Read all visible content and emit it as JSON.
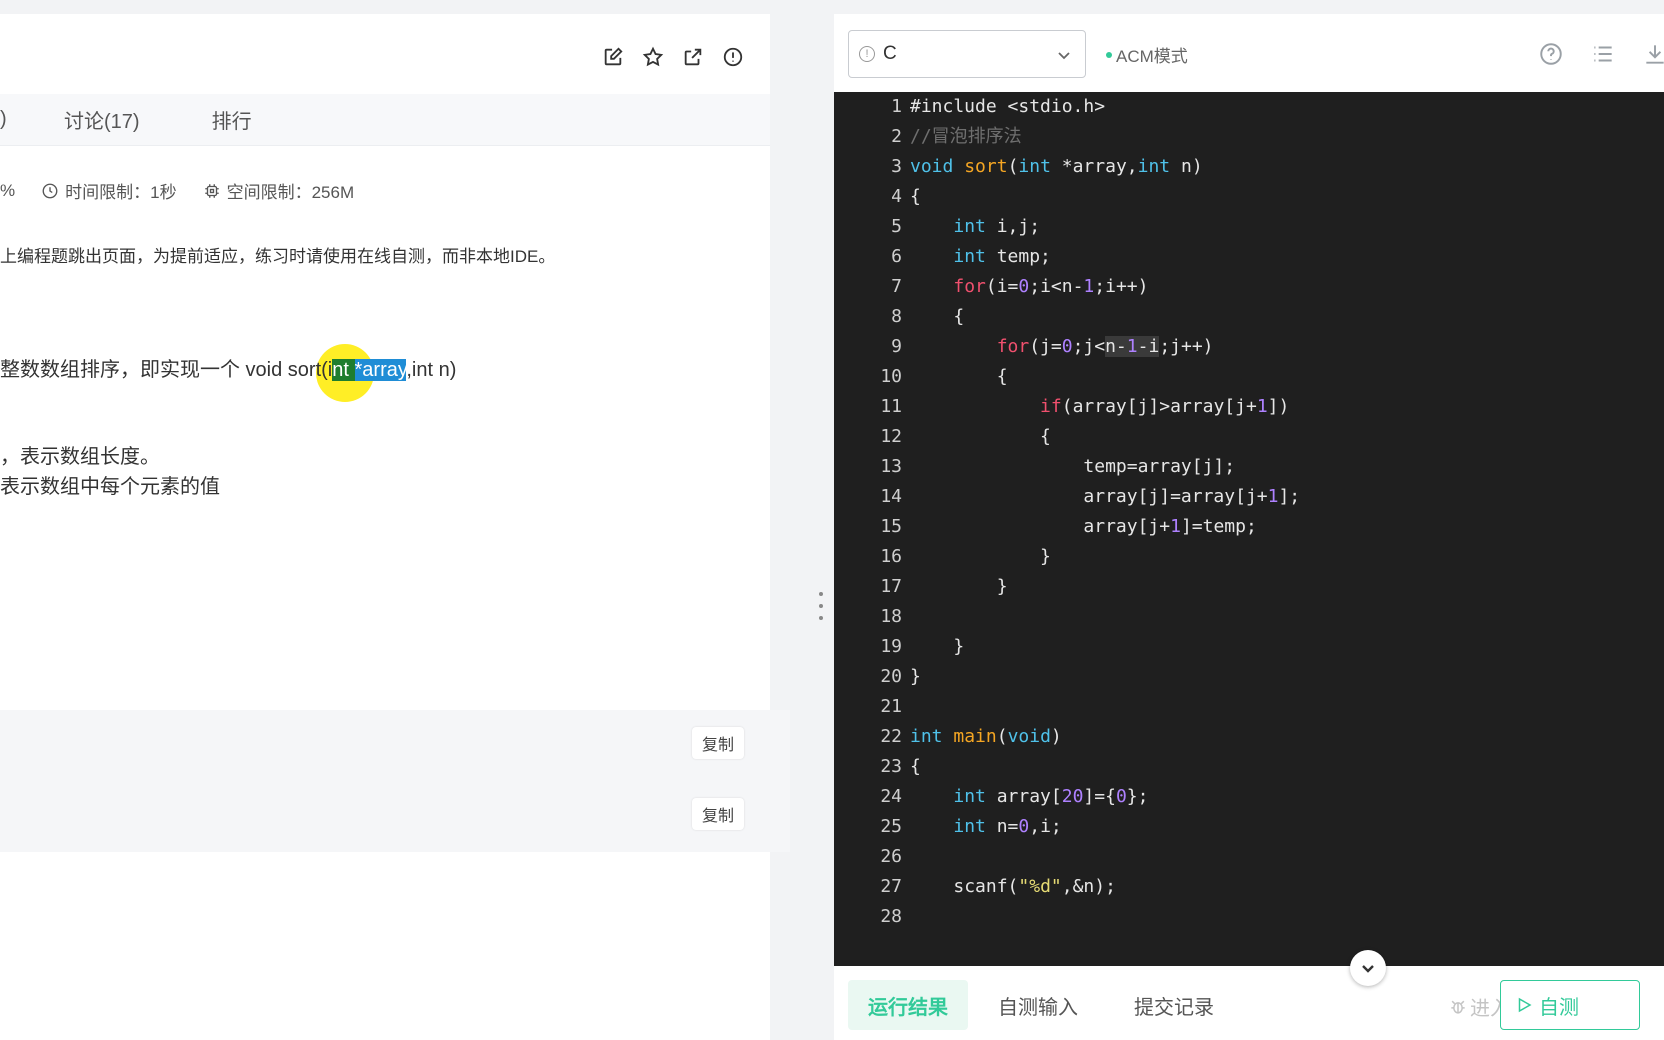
{
  "left": {
    "tabs": {
      "prev": ")",
      "discuss": "讨论(17)",
      "rank": "排行"
    },
    "meta": {
      "percent": "%",
      "time_limit": "时间限制：1秒",
      "space_limit": "空间限制：256M"
    },
    "notice": "上编程题跳出页面，为提前适应，练习时请使用在线自测，而非本地IDE。",
    "description": {
      "prefix": "整数数组排序，即实现一个 void sort(i",
      "green": "nt ",
      "blue": "*array",
      "suffix": ",int n)"
    },
    "input_desc": [
      "，表示数组长度。",
      "表示数组中每个元素的值"
    ],
    "copy_label_1": "复制",
    "copy_label_2": "复制"
  },
  "editor_header": {
    "language": "C",
    "mode": "ACM模式"
  },
  "code_lines": [
    {
      "n": "1"
    },
    {
      "n": "2"
    },
    {
      "n": "3"
    },
    {
      "n": "4"
    },
    {
      "n": "5"
    },
    {
      "n": "6"
    },
    {
      "n": "7"
    },
    {
      "n": "8"
    },
    {
      "n": "9"
    },
    {
      "n": "10"
    },
    {
      "n": "11"
    },
    {
      "n": "12"
    },
    {
      "n": "13"
    },
    {
      "n": "14"
    },
    {
      "n": "15"
    },
    {
      "n": "16"
    },
    {
      "n": "17"
    },
    {
      "n": "18"
    },
    {
      "n": "19"
    },
    {
      "n": "20"
    },
    {
      "n": "21"
    },
    {
      "n": "22"
    },
    {
      "n": "23"
    },
    {
      "n": "24"
    },
    {
      "n": "25"
    },
    {
      "n": "26"
    },
    {
      "n": "27"
    },
    {
      "n": "28"
    }
  ],
  "code_text": {
    "l1": "#include <stdio.h>",
    "l2": "//冒泡排序法",
    "l5": "int",
    "l5b": " i,j;",
    "l6": "int",
    "l6b": " temp;",
    "l13": "temp=array[j];",
    "l15a": "array[j+",
    "l15b": "1",
    "l15c": "]=temp;",
    "l27a": "scanf(",
    "l27b": "\"%d\"",
    "l27c": ",&n);"
  },
  "bottom": {
    "run_result": "运行结果",
    "self_input": "自测输入",
    "submit_history": "提交记录",
    "debug": "进入调试",
    "self_test": "自测"
  },
  "colors": {
    "accent": "#32ca99",
    "editor_bg": "#1f1f1f",
    "keyword": "#4fc1e9",
    "control": "#f0506e",
    "function": "#f5a623",
    "number": "#ae81ff"
  }
}
